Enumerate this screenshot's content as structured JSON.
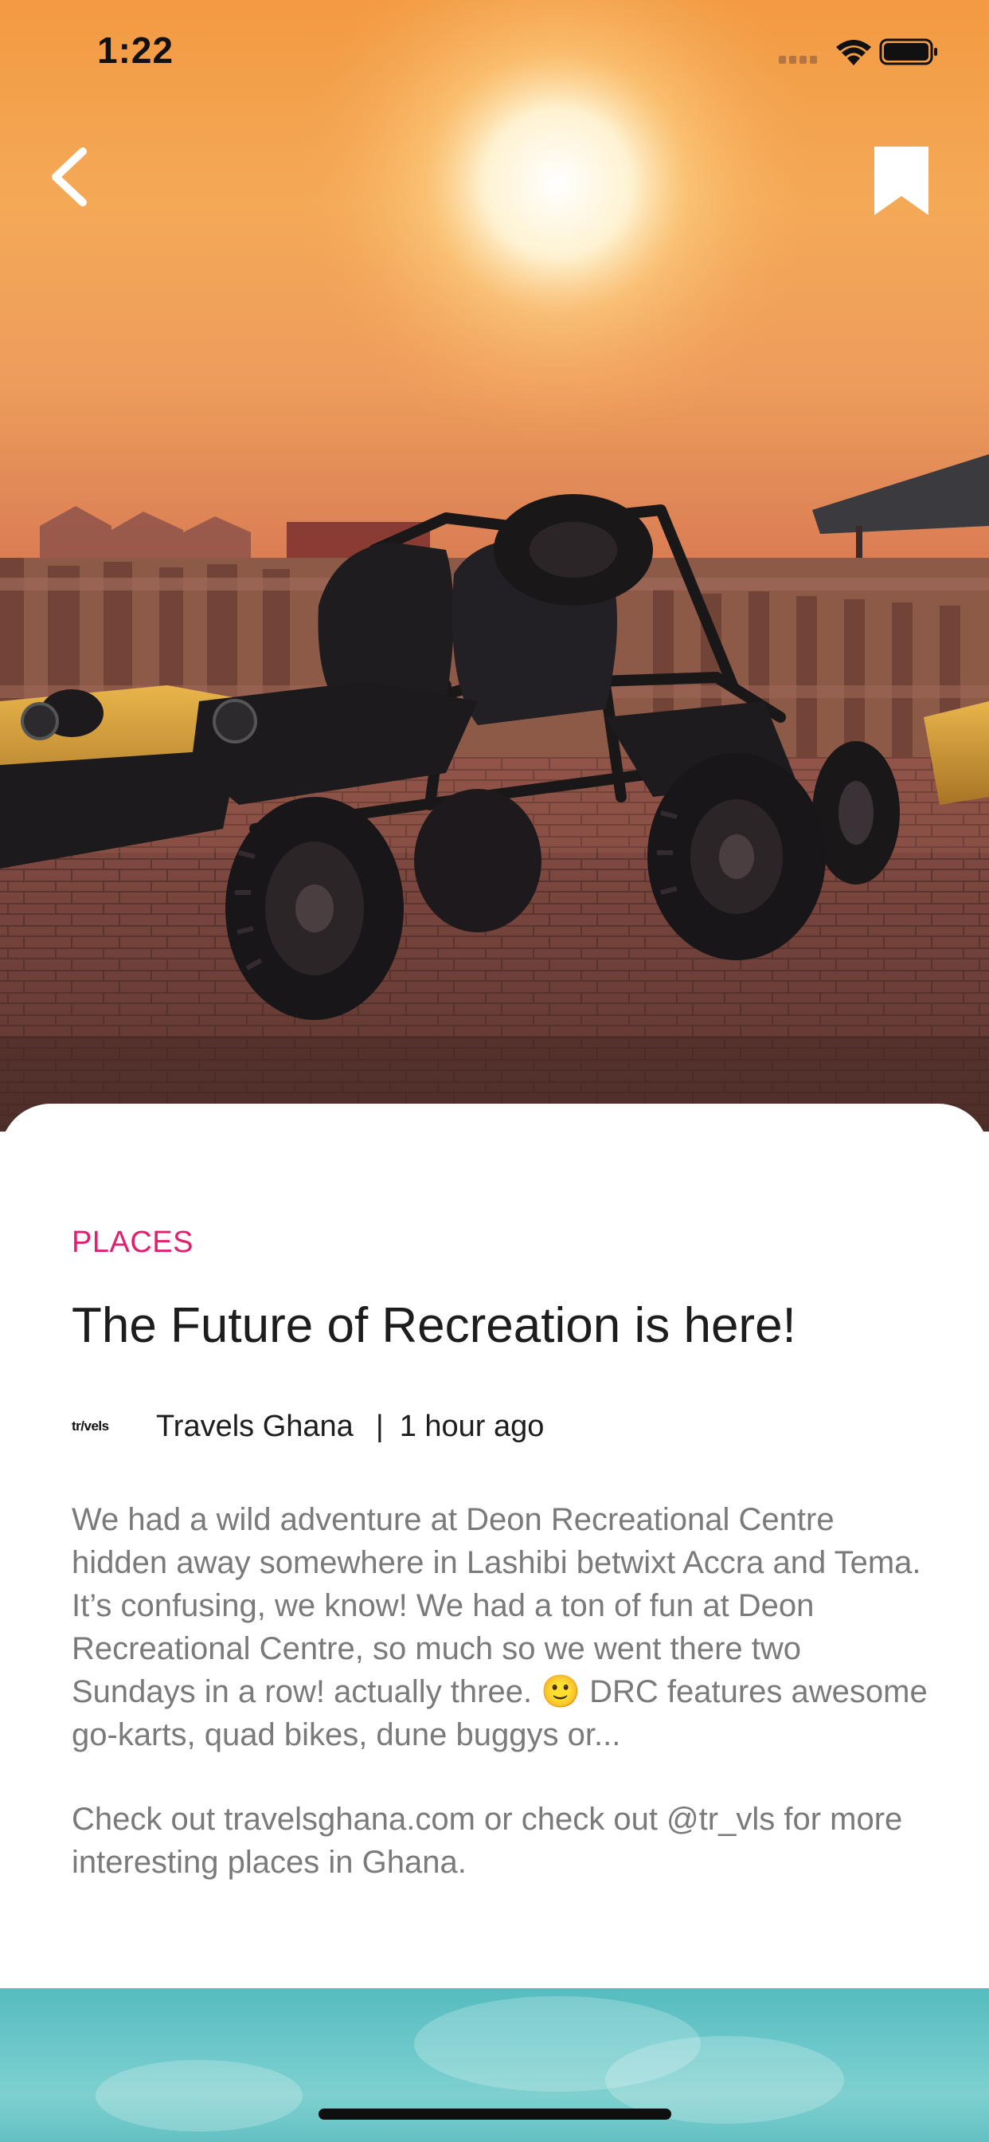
{
  "status_bar": {
    "time": "1:22"
  },
  "nav": {
    "back_icon": "chevron-left-icon",
    "bookmark_icon": "bookmark-icon"
  },
  "article": {
    "category": "PLACES",
    "title": "The Future of Recreation is here!",
    "source_logo_text": "tr/vels",
    "source_name": "Travels Ghana",
    "separator": "|",
    "time_ago": "1 hour ago",
    "body_paragraph_1": "We had a wild adventure at Deon Recreational Centre hidden away somewhere in Lashibi betwixt Accra and Tema. It’s confusing, we know! We had a ton of fun at Deon Recreational Centre, so much so we went there two Sundays in a row! actually three. 🙂 DRC features awesome go-karts, quad bikes, dune buggys or...",
    "body_paragraph_2": "Check out travelsghana.com or check out @tr_vls for more interesting places in Ghana."
  },
  "colors": {
    "category_accent": "#e0226e",
    "title_text": "#1d1d1d",
    "body_text": "#7a7a7a",
    "next_preview": "#6cc8ca"
  }
}
